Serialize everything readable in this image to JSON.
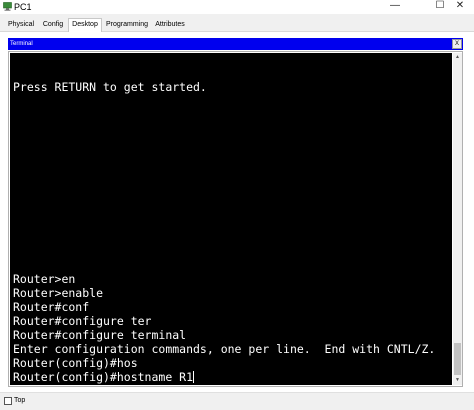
{
  "window": {
    "title": "PC1",
    "icon": "pc-icon",
    "minimize": "—",
    "maximize": "☐",
    "close": "✕"
  },
  "tabs": [
    {
      "label": "Physical"
    },
    {
      "label": "Config"
    },
    {
      "label": "Desktop",
      "selected": true
    },
    {
      "label": "Programming"
    },
    {
      "label": "Attributes"
    }
  ],
  "terminal": {
    "title": "Terminal",
    "close": "X",
    "lines": [
      "Press RETURN to get started.",
      "Router>en",
      "Router>enable",
      "Router#conf",
      "Router#configure ter",
      "Router#configure terminal",
      "Enter configuration commands, one per line.  End with CNTL/Z.",
      "Router(config)#hos",
      "Router(config)#hostname R1"
    ],
    "colors": {
      "background": "#000000",
      "text": "#ffffff",
      "header": "#0000ee"
    }
  },
  "scrollbar": {
    "up": "▲",
    "down": "▼"
  },
  "footer": {
    "top_label": "Top",
    "top_checked": false
  }
}
